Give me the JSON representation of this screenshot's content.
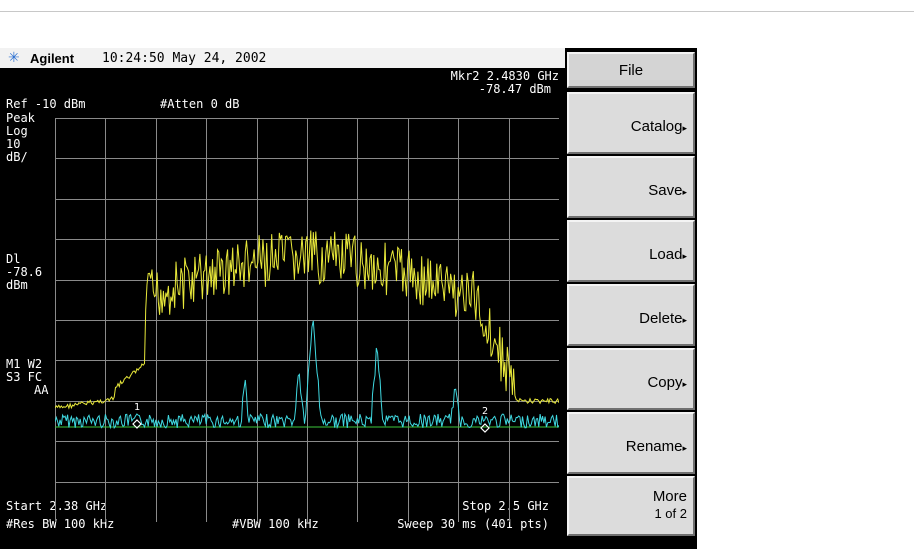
{
  "header": {
    "brand": "Agilent",
    "datetime": "10:24:50  May 24, 2002"
  },
  "readouts": {
    "marker": "Mkr2  2.4830 GHz",
    "marker_level": "-78.47 dBm",
    "ref_level": "Ref -10 dBm",
    "atten": "#Atten 0 dB",
    "detector": "Peak",
    "scale_type": "Log",
    "scale_value": "10",
    "scale_unit": "dB/",
    "dl_label": "Dl",
    "dl_value": "-78.6",
    "dl_unit": "dBm",
    "trace_mode_1": "M1  W2",
    "trace_mode_2": "S3  FC",
    "trace_mode_3": "AA",
    "marker1_label": "1",
    "marker2_label": "2"
  },
  "footer": {
    "start": "Start 2.38 GHz",
    "stop": "Stop 2.5 GHz",
    "res_bw": "#Res BW 100 kHz",
    "vbw": "#VBW 100 kHz",
    "sweep": "Sweep 30 ms (401 pts)"
  },
  "softkeys": {
    "title": "File",
    "items": [
      {
        "label": "Catalog"
      },
      {
        "label": "Save"
      },
      {
        "label": "Load"
      },
      {
        "label": "Delete"
      },
      {
        "label": "Copy"
      },
      {
        "label": "Rename"
      }
    ],
    "more": "More",
    "more_page": "1 of 2",
    "arrow": "▸"
  },
  "colors": {
    "trace_yellow": "#e8e83a",
    "trace_cyan": "#3fd8e0",
    "display_line": "#3cc83c",
    "grid": "#8a8a8a"
  }
}
